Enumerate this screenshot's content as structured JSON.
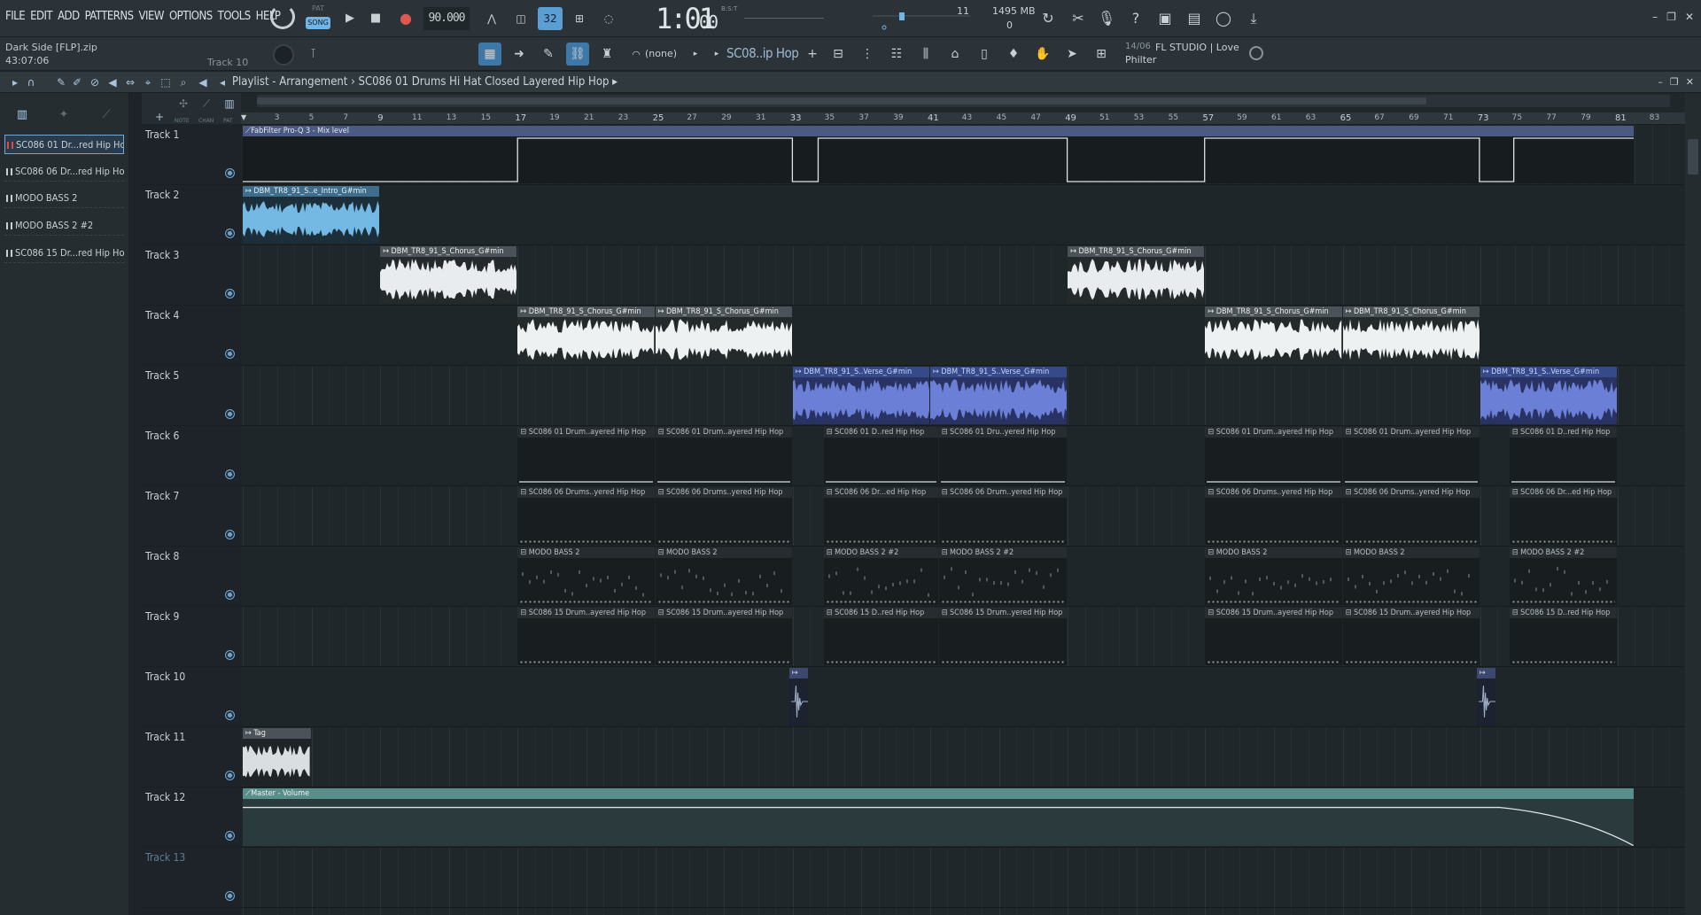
{
  "menu": [
    "FILE",
    "EDIT",
    "ADD",
    "PATTERNS",
    "VIEW",
    "OPTIONS",
    "TOOLS",
    "HELP"
  ],
  "project": {
    "title": "Dark Side [FLP].zip",
    "time": "43:07:06"
  },
  "transport": {
    "pat_label": "PAT",
    "song_label": "SONG",
    "tempo": "90.000",
    "clock_main": "1:01",
    "clock_sub": "00",
    "clock_tz": "B:S:T"
  },
  "meters": {
    "cpu": "11",
    "memory": "1495 MB",
    "polyphony": "0"
  },
  "toolbar2": {
    "track_hint": "Track 10",
    "pattern_none": "(none)",
    "pattern_name": "SC08..ip Hop",
    "news_date": "14/06",
    "news_title": "FL STUDIO | Love",
    "news_sub": "Philter"
  },
  "playlist": {
    "breadcrumb_a": "Playlist - Arrangement",
    "breadcrumb_sep": "›",
    "breadcrumb_b": "SC086 01 Drums Hi Hat Closed Layered Hip Hop",
    "mini_labels": [
      "NOTE",
      "CHAN",
      "PAT"
    ]
  },
  "picker": [
    {
      "label": "SC086 01 Dr...red Hip Hop",
      "selected": true
    },
    {
      "label": "SC086 06 Dr...red Hip Hop",
      "selected": false
    },
    {
      "label": "MODO BASS 2",
      "selected": false
    },
    {
      "label": "MODO BASS 2 #2",
      "selected": false
    },
    {
      "label": "SC086 15 Dr...red Hip Hop",
      "selected": false
    }
  ],
  "ruler": [
    "3",
    "5",
    "7",
    "9",
    "11",
    "13",
    "15",
    "17",
    "19",
    "21",
    "23",
    "25",
    "27",
    "29",
    "31",
    "33",
    "35",
    "37",
    "39",
    "41",
    "43",
    "45",
    "47",
    "49",
    "51",
    "53",
    "55",
    "57",
    "59",
    "61",
    "63",
    "65",
    "67",
    "69",
    "71",
    "73",
    "75",
    "77",
    "79",
    "81",
    "83"
  ],
  "tracks": [
    "Track 1",
    "Track 2",
    "Track 3",
    "Track 4",
    "Track 5",
    "Track 6",
    "Track 7",
    "Track 8",
    "Track 9",
    "Track 10",
    "Track 11",
    "Track 12",
    "Track 13"
  ],
  "clips": {
    "fab": "FabFilter Pro-Q 3 - Mix level",
    "intro": "DBM_TR8_91_S..e_Intro_G#min",
    "chorus": "DBM_TR8_91_S_Chorus_G#min",
    "verse": "DBM_TR8_91_S..Verse_G#min",
    "p6a": "SC086 01 Drum..ayered Hip Hop",
    "p6b": "SC086 01 D..red Hip Hop",
    "p6c": "SC086 01 Dru..yered Hip Hop",
    "p7a": "SC086 06 Drums..yered Hip Hop",
    "p7b": "SC086 06 Dr...ed Hip Hop",
    "p7c": "SC086 06 Drum..yered Hip Hop",
    "p8a": "MODO BASS 2",
    "p8b": "MODO BASS 2 #2",
    "p9a": "SC086 15 Drum..ayered Hip Hop",
    "p9b": "SC086 15 D..red Hip Hop",
    "p9c": "SC086 15 Drum..yered Hip Hop",
    "tag": "Tag",
    "master": "Master - Volume"
  },
  "colors": {
    "accent": "#6fb5e8",
    "audio_blue": "#6fb5e8",
    "audio_purple": "#6b7fd6",
    "master_auto": "#5a8e8a"
  },
  "icons": [
    "master-volume-knob",
    "play-icon",
    "stop-icon",
    "record-icon",
    "metronome-icon",
    "undo-icon",
    "mic-icon",
    "help-icon",
    "save-icon",
    "chat-icon",
    "download-icon",
    "globe-icon"
  ]
}
